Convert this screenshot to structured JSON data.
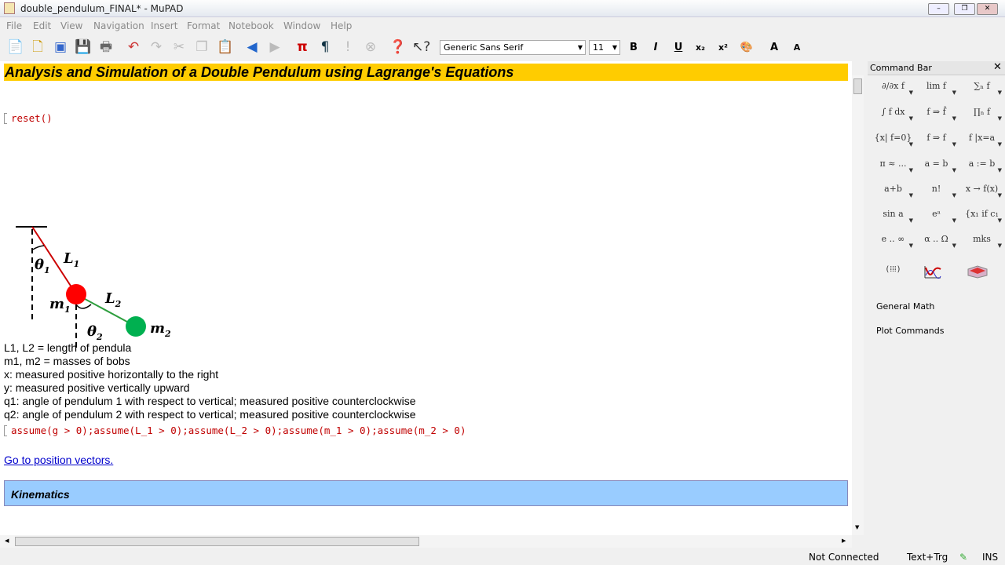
{
  "window": {
    "title": "double_pendulum_FINAL* - MuPAD"
  },
  "menu": [
    "File",
    "Edit",
    "View",
    "Navigation",
    "Insert",
    "Format",
    "Notebook",
    "Window",
    "Help"
  ],
  "toolbar": {
    "font": "Generic Sans Serif",
    "size": "11",
    "bold": "B",
    "italic": "I",
    "underline": "U",
    "subscript": "x₂",
    "superscript": "x²",
    "grow": "A",
    "shrink": "A"
  },
  "document": {
    "title": "Analysis and Simulation of a Double Pendulum using Lagrange's Equations",
    "reset_cmd": "reset()",
    "figure": {
      "L1": "L",
      "L1_sub": "1",
      "L2": "L",
      "L2_sub": "2",
      "m1": "m",
      "m1_sub": "1",
      "m2": "m",
      "m2_sub": "2",
      "theta1": "θ",
      "theta1_sub": "1",
      "theta2": "θ",
      "theta2_sub": "2",
      "colors": {
        "bob1": "#ff0000",
        "bob2": "#00b050",
        "rod1": "#cc0000",
        "rod2": "#2e9e3e"
      }
    },
    "description": [
      "L1, L2 = length of pendula",
      "m1, m2 = masses of bobs",
      "x: measured positive horizontally to the right",
      "y: measured positive vertically upward",
      "q1: angle of pendulum 1 with respect to vertical; measured positive counterclockwise",
      "q2: angle of pendulum 2 with respect to vertical; measured positive counterclockwise"
    ],
    "assume_cmd": "assume(g > 0);assume(L_1 > 0);assume(L_2 > 0);assume(m_1 > 0);assume(m_2 > 0)",
    "link": "Go to position vectors.",
    "section": "Kinematics"
  },
  "command_bar": {
    "title": "Command Bar",
    "items": [
      "∂/∂x f",
      "lim f",
      "∑ₙ f",
      "∫ f dx",
      "f ⇒ f̂",
      "∏ₙ f",
      "{x| f=0}",
      "f ⇒ f",
      "f |x=a",
      "π ≈ ...",
      "a = b",
      "a := b",
      "a+b",
      "n!",
      "x → f(x)",
      "sin a",
      "eᵃ",
      "{x₁ if c₁",
      "e .. ∞",
      "α .. Ω",
      "mks"
    ],
    "general_math": "General Math",
    "plot_commands": "Plot Commands"
  },
  "status": {
    "connection": "Not Connected",
    "mode": "Text+Trg",
    "insert": "INS"
  }
}
